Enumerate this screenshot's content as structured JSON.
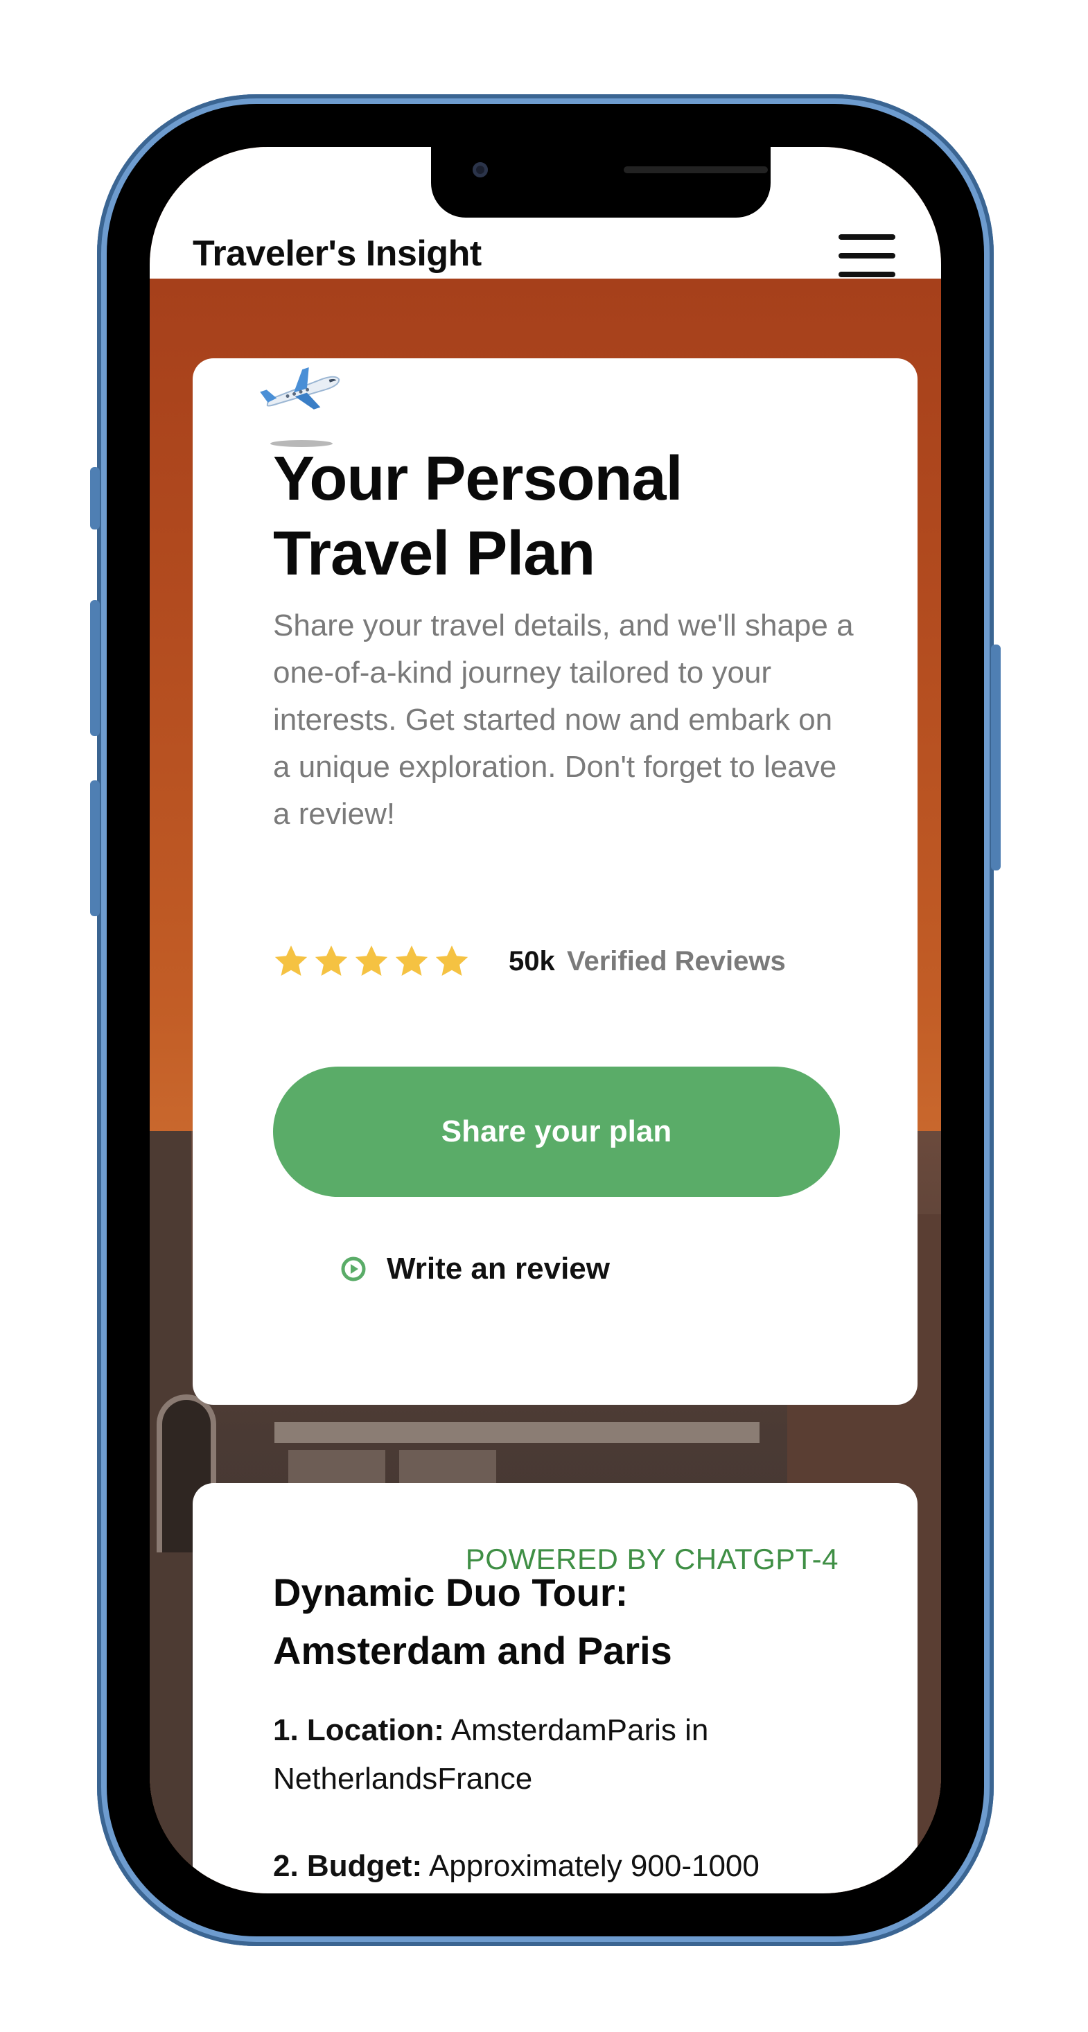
{
  "header": {
    "brand": "Traveler's Insight"
  },
  "hero_card": {
    "title": "Your Personal Travel Plan",
    "description": "Share your travel details, and we'll shape a one-of-a-kind journey tailored to your interests. Get started now and embark on a unique exploration. Don't forget to leave a review!",
    "rating_stars": 5,
    "reviews_count": "50k",
    "reviews_label": "Verified Reviews",
    "share_button": "Share your plan",
    "write_review": "Write an review"
  },
  "plan_card": {
    "powered_by": "POWERED BY CHATGPT-4",
    "title": "Dynamic Duo Tour: Amsterdam and Paris",
    "items": [
      {
        "label": "1. Location:",
        "value": "AmsterdamParis in NetherlandsFrance"
      },
      {
        "label": "2. Budget:",
        "value": "Approximately 900-1000"
      }
    ]
  },
  "colors": {
    "accent_green": "#5aac68",
    "powered_green": "#3f8f45",
    "star_yellow": "#f5c242",
    "background_orange": "#a9441c"
  }
}
